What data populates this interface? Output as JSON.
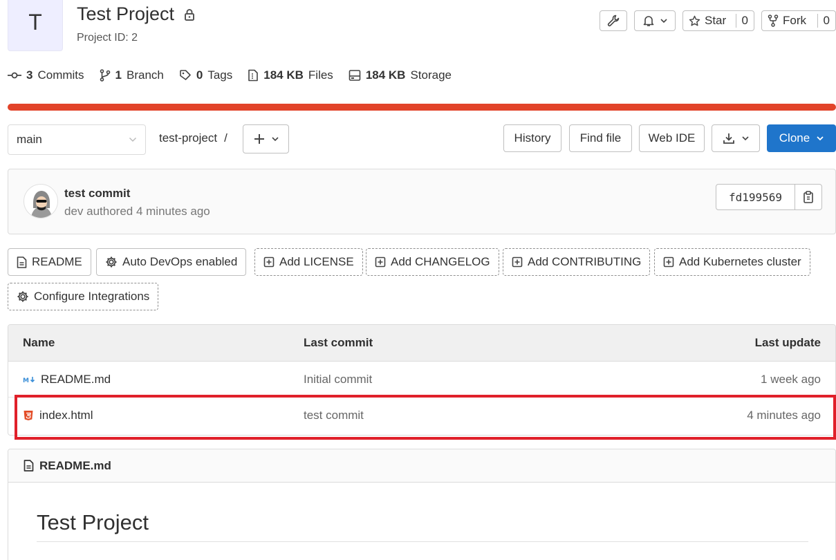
{
  "project": {
    "avatar_letter": "T",
    "title": "Test Project",
    "id_text": "Project ID: 2"
  },
  "header_actions": {
    "star_label": "Star",
    "star_count": "0",
    "fork_label": "Fork",
    "fork_count": "0"
  },
  "stats": [
    {
      "num": "3",
      "label": "Commits"
    },
    {
      "num": "1",
      "label": "Branch"
    },
    {
      "num": "0",
      "label": "Tags"
    },
    {
      "num": "184 KB",
      "label": "Files"
    },
    {
      "num": "184 KB",
      "label": "Storage"
    }
  ],
  "colors": {
    "accent": "#1f75cb",
    "language_bar": "#e24329",
    "highlight": "#e0202a"
  },
  "toolbar": {
    "branch": "main",
    "path": "test-project",
    "separator": "/",
    "history": "History",
    "find_file": "Find file",
    "web_ide": "Web IDE",
    "clone": "Clone"
  },
  "commit": {
    "title": "test commit",
    "meta": "dev authored 4 minutes ago",
    "sha": "fd199569"
  },
  "quick_buttons": [
    {
      "label": "README"
    },
    {
      "label": "Auto DevOps enabled"
    },
    {
      "label": "Add LICENSE"
    },
    {
      "label": "Add CHANGELOG"
    },
    {
      "label": "Add CONTRIBUTING"
    },
    {
      "label": "Add Kubernetes cluster"
    },
    {
      "label": "Configure Integrations"
    }
  ],
  "file_table": {
    "headers": {
      "name": "Name",
      "last_commit": "Last commit",
      "last_update": "Last update"
    },
    "rows": [
      {
        "name": "README.md",
        "commit": "Initial commit",
        "updated": "1 week ago",
        "icon": "markdown-icon"
      },
      {
        "name": "index.html",
        "commit": "test commit",
        "updated": "4 minutes ago",
        "icon": "html5-icon"
      }
    ]
  },
  "readme": {
    "file": "README.md",
    "heading": "Test Project"
  }
}
